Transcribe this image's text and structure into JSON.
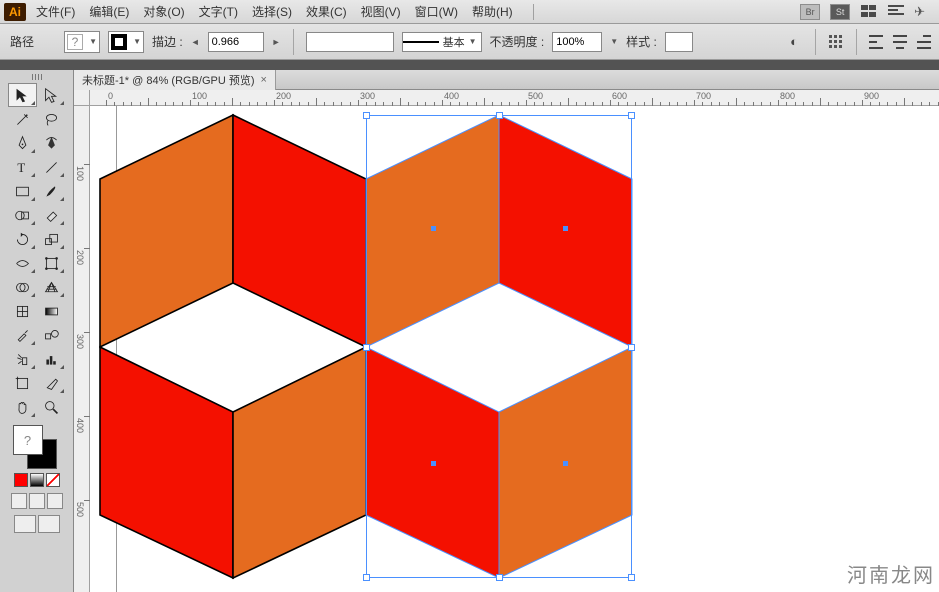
{
  "app": {
    "logo_text": "Ai"
  },
  "menu": {
    "file": "文件(F)",
    "edit": "编辑(E)",
    "object": "对象(O)",
    "type": "文字(T)",
    "select": "选择(S)",
    "effect": "效果(C)",
    "view": "视图(V)",
    "window": "窗口(W)",
    "help": "帮助(H)"
  },
  "topright": {
    "br": "Br",
    "st": "St"
  },
  "options": {
    "title": "路径",
    "stroke_label": "描边 :",
    "stroke_value": "0.966",
    "profile_label": "基本",
    "opacity_label": "不透明度 :",
    "opacity_value": "100%",
    "style_label": "样式 :"
  },
  "tab": {
    "title": "未标题-1* @ 84% (RGB/GPU 预览)"
  },
  "ruler": {
    "h": [
      "0",
      "100",
      "200",
      "300",
      "400",
      "500",
      "600",
      "700",
      "800",
      "900"
    ],
    "v": [
      "100",
      "200",
      "300",
      "400",
      "500"
    ]
  },
  "swatches": {
    "fill_unknown": "?",
    "mini": [
      "#ff0000",
      "#ffffff",
      "#000000"
    ]
  },
  "canvas": {
    "orange": "#e56b1f",
    "red": "#f41000",
    "stroke_black": "#000000",
    "stroke_sel": "#4a90ff"
  },
  "watermark": "河南龙网"
}
